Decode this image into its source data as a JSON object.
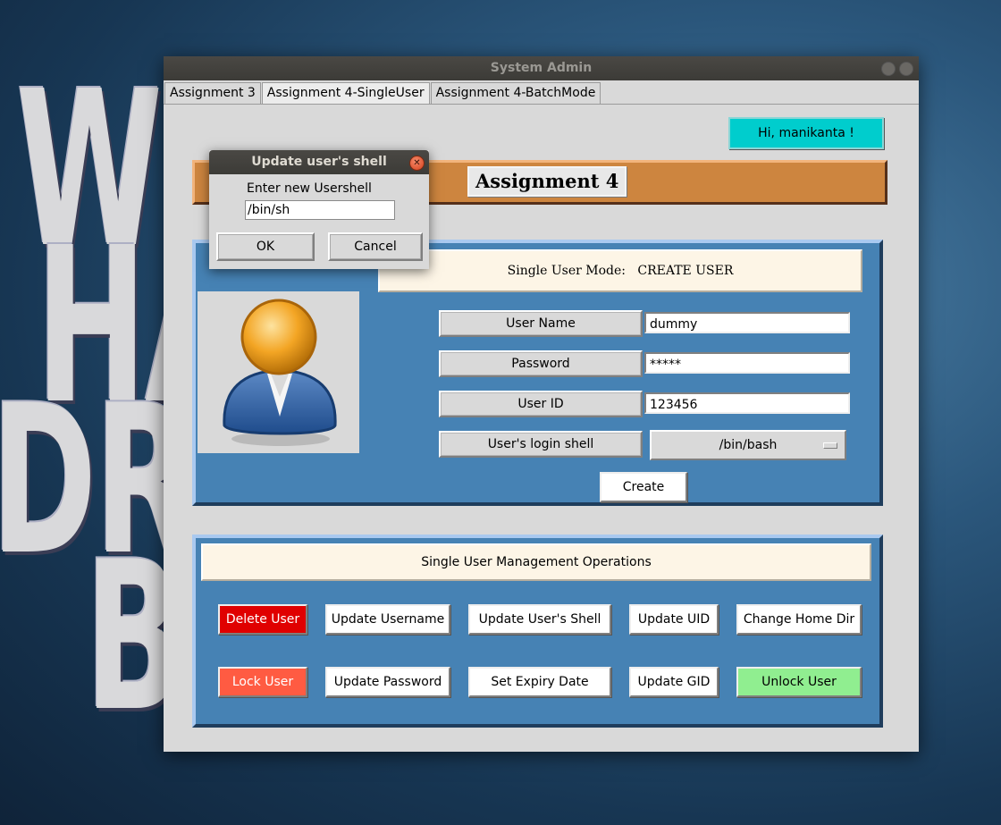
{
  "window": {
    "title": "System Admin"
  },
  "tabs": [
    {
      "label": "Assignment 3"
    },
    {
      "label": "Assignment 4-SingleUser"
    },
    {
      "label": "Assignment 4-BatchMode"
    }
  ],
  "greeting": "Hi, manikanta !",
  "banner": {
    "title": "Assignment 4"
  },
  "create_panel": {
    "mode_label": "Single User Mode:",
    "mode_value": "CREATE USER",
    "fields": {
      "username": {
        "label": "User Name",
        "value": "dummy"
      },
      "password": {
        "label": "Password",
        "value": "*****"
      },
      "uid": {
        "label": "User ID",
        "value": "123456"
      },
      "shell": {
        "label": "User's login shell",
        "value": "/bin/bash"
      }
    },
    "create_label": "Create"
  },
  "ops_panel": {
    "title": "Single User Management Operations",
    "buttons": {
      "delete_user": "Delete User",
      "update_username": "Update Username",
      "update_shell": "Update User's Shell",
      "update_uid": "Update UID",
      "change_home": "Change Home Dir",
      "lock_user": "Lock User",
      "update_password": "Update Password",
      "set_expiry": "Set Expiry Date",
      "update_gid": "Update GID",
      "unlock_user": "Unlock User"
    }
  },
  "dialog": {
    "title": "Update user's shell",
    "prompt": "Enter new Usershell",
    "value": "/bin/sh",
    "ok_label": "OK",
    "cancel_label": "Cancel"
  },
  "colors": {
    "panel_blue": "#4682b4",
    "banner_orange": "#cd853f",
    "cyan": "#00cdcd",
    "delete_red": "#e00000",
    "lock_red": "#ff5b42",
    "unlock_green": "#90ee90",
    "cream": "#fdf5e6"
  },
  "background_text": [
    "WO",
    "HA",
    "DR",
    "B"
  ]
}
